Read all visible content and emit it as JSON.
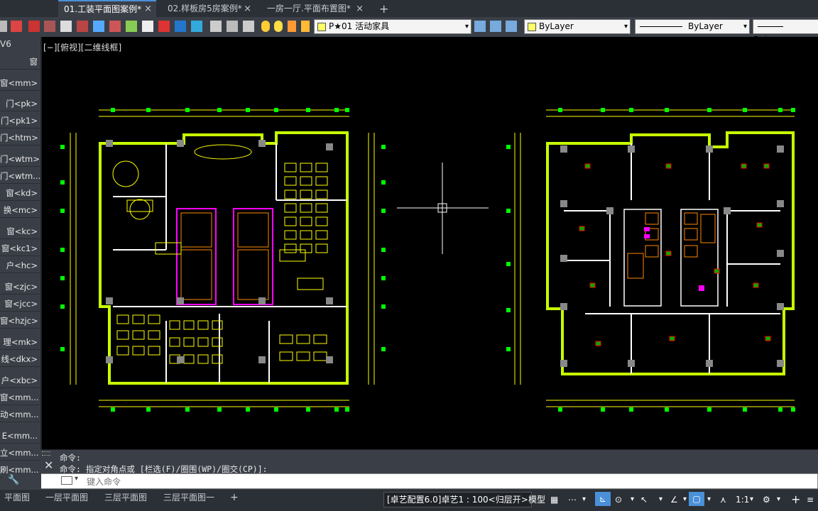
{
  "tabs": [
    {
      "label": "01.工装平面图案例*",
      "active": true
    },
    {
      "label": "02.样板房5房案例*",
      "active": false
    },
    {
      "label": "一房一厅.平面布置图*",
      "active": false
    }
  ],
  "tab_add": "+",
  "tab_close": "×",
  "toolbar": {
    "layer_value": "P★01 活动家具",
    "color_value": "ByLayer",
    "linetype_value": "ByLayer",
    "lineweight_value": "ByLayer"
  },
  "sidebar": {
    "title": "V6",
    "items": [
      "窗",
      "窗<mm>",
      "门<pk>",
      "门<pk1>",
      "门<htm>",
      "门<wtm>",
      "门<wtm...",
      "窗<kd>",
      "换<mc>",
      "窗<kc>",
      "窗<kc1>",
      "户<hc>",
      "窗<zjc>",
      "窗<jcc>",
      "窗<hzjc>",
      "理<mk>",
      "线<dkx>",
      "户<xbc>",
      "窗<mm...",
      "动<mm...",
      "E<mm...",
      "立<mm...",
      "刷<mm..."
    ]
  },
  "viewport_label": "[−][俯视][二维线框]",
  "command": {
    "line1": "命令:",
    "line2": "命令: 指定对角点或 [栏选(F)/圈围(WP)/圈交(CP)]:",
    "placeholder": "键入命令"
  },
  "layout_tabs": [
    "平面图",
    "一层平面图",
    "三层平面图",
    "三层平面图一"
  ],
  "layout_add": "+",
  "status": {
    "config": "[卓艺配置6.0]卓艺1 : 100<归层开>",
    "model": "模型",
    "scale": "1:1"
  },
  "colors": {
    "accent": "#4a90d9",
    "cad_yellow": "#ffff00",
    "cad_green": "#c8ff00",
    "cad_magenta": "#ff00ff"
  }
}
